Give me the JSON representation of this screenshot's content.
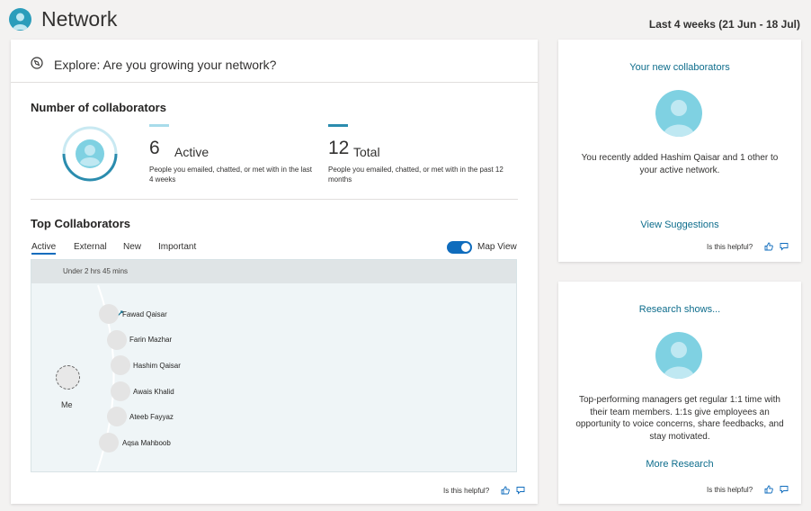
{
  "header": {
    "title": "Network",
    "date_range": "Last 4 weeks (21 Jun - 18 Jul)"
  },
  "explore": {
    "title": "Explore: Are you growing your network?"
  },
  "collaborators": {
    "title": "Number of collaborators",
    "active": {
      "value": "6",
      "label": "Active",
      "description": "People you emailed, chatted, or met with in the last 4 weeks"
    },
    "total": {
      "value": "12",
      "label": "Total",
      "description": "People you emailed, chatted, or met with in the past 12 months"
    },
    "active_fraction": 0.5
  },
  "top_collaborators": {
    "title": "Top Collaborators",
    "tabs": [
      "Active",
      "External",
      "New",
      "Important"
    ],
    "selected_tab": "Active",
    "map_view_label": "Map View",
    "map_view_on": true,
    "map_header": "Under 2 hrs 45 mins",
    "me_label": "Me",
    "people": [
      "Fawad Qaisar",
      "Farin Mazhar",
      "Hashim Qaisar",
      "Awais Khalid",
      "Ateeb Fayyaz",
      "Aqsa Mahboob"
    ]
  },
  "feedback": {
    "question": "Is this helpful?"
  },
  "new_collaborators": {
    "title": "Your new collaborators",
    "text": "You recently added Hashim Qaisar and 1 other to your active network.",
    "link": "View Suggestions"
  },
  "research": {
    "title": "Research shows...",
    "text": "Top-performing managers get regular 1:1 time with their team members. 1:1s give employees an opportunity to voice concerns, share feedbacks, and stay motivated.",
    "link": "More Research"
  },
  "colors": {
    "accent": "#0f6cbd",
    "teal": "#0e6d8c",
    "active_bar": "#a8dceb",
    "total_bar": "#2b8cae",
    "avatar_bg": "#7fd1e2"
  },
  "icons": [
    "app-logo-icon",
    "compass-icon",
    "thumbs-up-icon",
    "comment-icon",
    "person-avatar-icon"
  ]
}
